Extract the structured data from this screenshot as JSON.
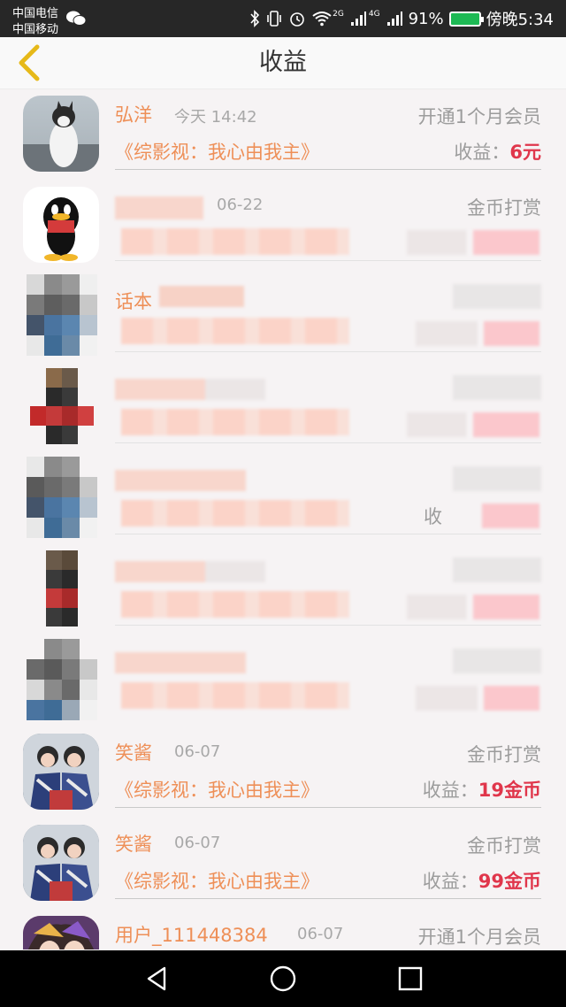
{
  "status_bar": {
    "carrier_1": "中国电信",
    "carrier_2": "中国移动",
    "signal_2g": "2G",
    "signal_4g": "4G",
    "battery": "91%",
    "time": "傍晚5:34",
    "icons": [
      "wechat-icon",
      "bluetooth-icon",
      "vibrate-icon",
      "alarm-icon",
      "wifi-icon",
      "signal-icon",
      "battery-icon"
    ]
  },
  "header": {
    "title": "收益",
    "back_icon": "chevron-left-icon"
  },
  "colors": {
    "accent": "#ee8f57",
    "earning": "#e0364b",
    "muted": "#9c9c9c",
    "back": "#e6b919"
  },
  "list": {
    "visible": [
      {
        "name": "弘洋",
        "time": "今天 14:42",
        "type": "开通1个月会员",
        "show": "《综影视：我心由我主》",
        "earn_label": "收益：",
        "earn_value": "6元"
      },
      {
        "name": "",
        "time": "06-22",
        "type": "金币打赏",
        "show": "",
        "earn_label": "",
        "earn_value": ""
      },
      {
        "name": "话本",
        "time": "",
        "type": "",
        "show": "",
        "earn_label": "",
        "earn_value": ""
      },
      {
        "name": "",
        "time": "",
        "type": "",
        "show": "",
        "earn_label": "",
        "earn_value": ""
      },
      {
        "name": "",
        "time": "",
        "type": "",
        "show": "",
        "earn_label": "收",
        "earn_value": ""
      },
      {
        "name": "",
        "time": "",
        "type": "",
        "show": "",
        "earn_label": "",
        "earn_value": ""
      },
      {
        "name": "",
        "time": "",
        "type": "",
        "show": "",
        "earn_label": "",
        "earn_value": ""
      },
      {
        "name": "笑酱",
        "time": "06-07",
        "type": "金币打赏",
        "show": "《综影视：我心由我主》",
        "earn_label": "收益：",
        "earn_value": "19金币"
      },
      {
        "name": "笑酱",
        "time": "06-07",
        "type": "金币打赏",
        "show": "《综影视：我心由我主》",
        "earn_label": "收益：",
        "earn_value": "99金币"
      },
      {
        "name": "用户_111448384",
        "time": "06-07",
        "type": "开通1个月会员",
        "show": "",
        "earn_label": "",
        "earn_value": ""
      }
    ]
  },
  "nav_bar": {
    "icons": [
      "back-triangle-icon",
      "home-circle-icon",
      "recent-square-icon"
    ]
  }
}
